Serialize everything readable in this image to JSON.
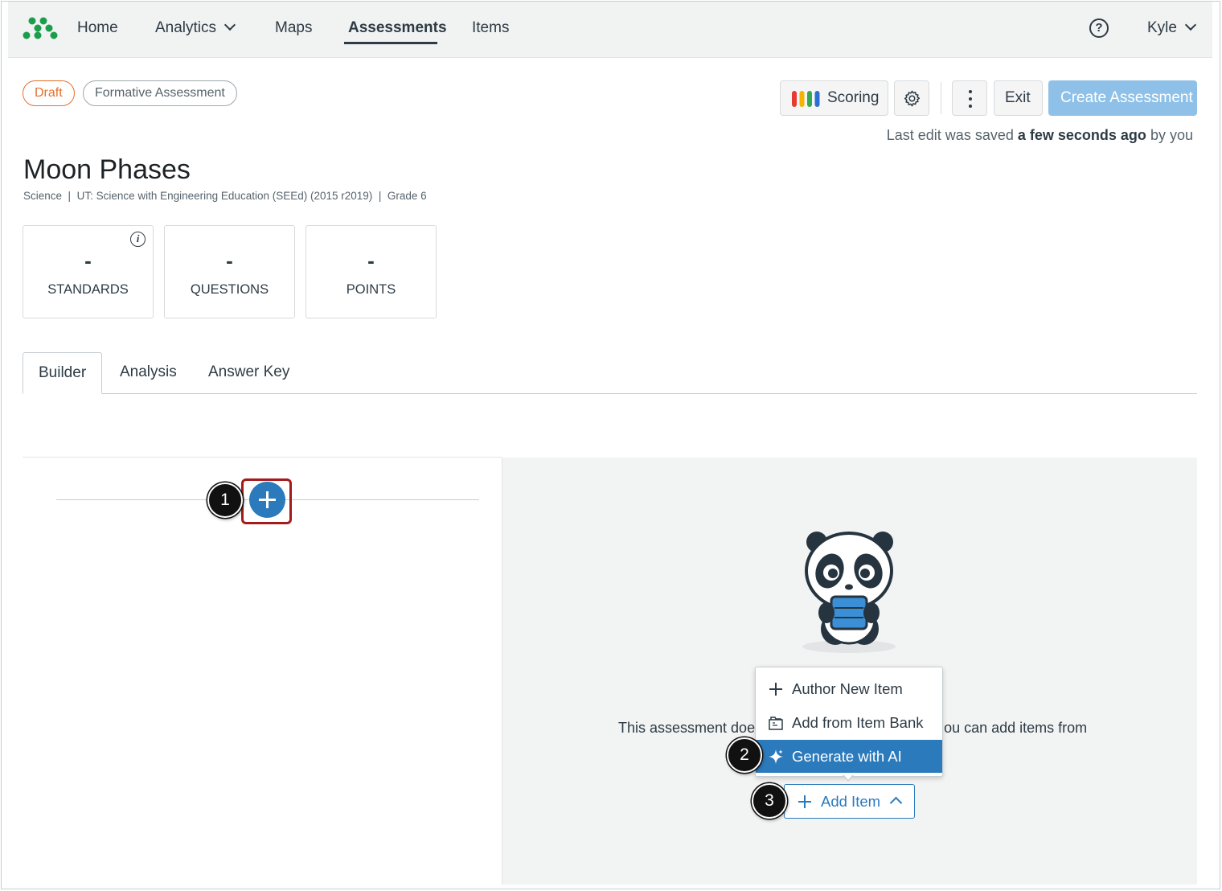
{
  "nav": {
    "home": "Home",
    "analytics": "Analytics",
    "maps": "Maps",
    "assessments": "Assessments",
    "items": "Items",
    "help_icon": "?",
    "user": "Kyle"
  },
  "pills": {
    "status": "Draft",
    "type": "Formative Assessment"
  },
  "toolbar": {
    "scoring": "Scoring",
    "exit": "Exit",
    "create": "Create Assessment",
    "saved_prefix": "Last edit was saved",
    "saved_bold": "a few seconds ago",
    "saved_suffix": "by you"
  },
  "assessment": {
    "title": "Moon Phases",
    "subject": "Science",
    "framework": "UT: Science with Engineering Education (SEEd) (2015 r2019)",
    "grade": "Grade 6",
    "separator": "|"
  },
  "stats": [
    {
      "value": "-",
      "label": "STANDARDS"
    },
    {
      "value": "-",
      "label": "QUESTIONS"
    },
    {
      "value": "-",
      "label": "POINTS"
    }
  ],
  "info_icon": "i",
  "tabs": [
    "Builder",
    "Analysis",
    "Answer Key"
  ],
  "empty_state": {
    "left": "This assessment does",
    "right": "ou can add items from"
  },
  "menu": {
    "items": [
      "Author New Item",
      "Add from Item Bank",
      "Generate with AI"
    ],
    "selected_index": 2
  },
  "add_item": "Add Item",
  "callouts": [
    "1",
    "2",
    "3"
  ],
  "colors": {
    "accent": "#2b7abc",
    "draft": "#e5702a",
    "callout_highlight": "#a31b1b",
    "create_button": "#8fc1e8"
  }
}
